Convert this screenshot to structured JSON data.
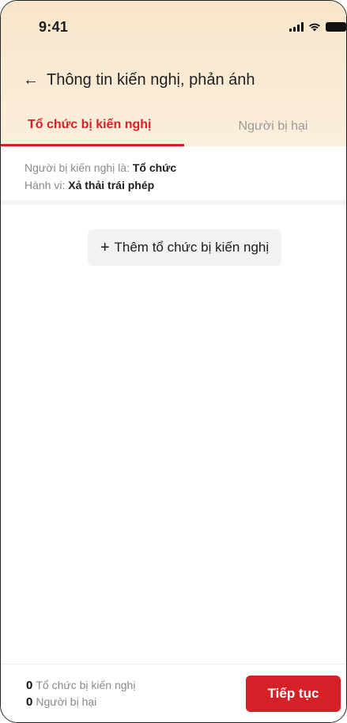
{
  "status_bar": {
    "time": "9:41",
    "icons": [
      "cellular-signal-icon",
      "wifi-icon",
      "battery-icon"
    ]
  },
  "header": {
    "back_icon": "arrow-left-icon",
    "title": "Thông tin kiến nghị, phản ánh"
  },
  "tabs": [
    {
      "label": "Tổ chức bị kiến nghị",
      "active": true
    },
    {
      "label": "Người bị hại",
      "active": false
    }
  ],
  "info": {
    "subject_label": "Người bị kiến nghị là:",
    "subject_value": "Tổ chức",
    "behavior_label": "Hành vi:",
    "behavior_value": "Xả thải trái phép"
  },
  "add_button": {
    "icon": "plus-icon",
    "label": "Thêm tổ chức bị kiến nghị"
  },
  "footer": {
    "org_count": "0",
    "org_label": "Tổ chức bị kiến nghị",
    "victim_count": "0",
    "victim_label": "Người bị hại",
    "continue_label": "Tiếp tục"
  },
  "colors": {
    "accent": "#d52027",
    "header_background": "#f8e8cf",
    "muted_text": "#8a8a8a",
    "button_background": "#f2f2f2"
  }
}
